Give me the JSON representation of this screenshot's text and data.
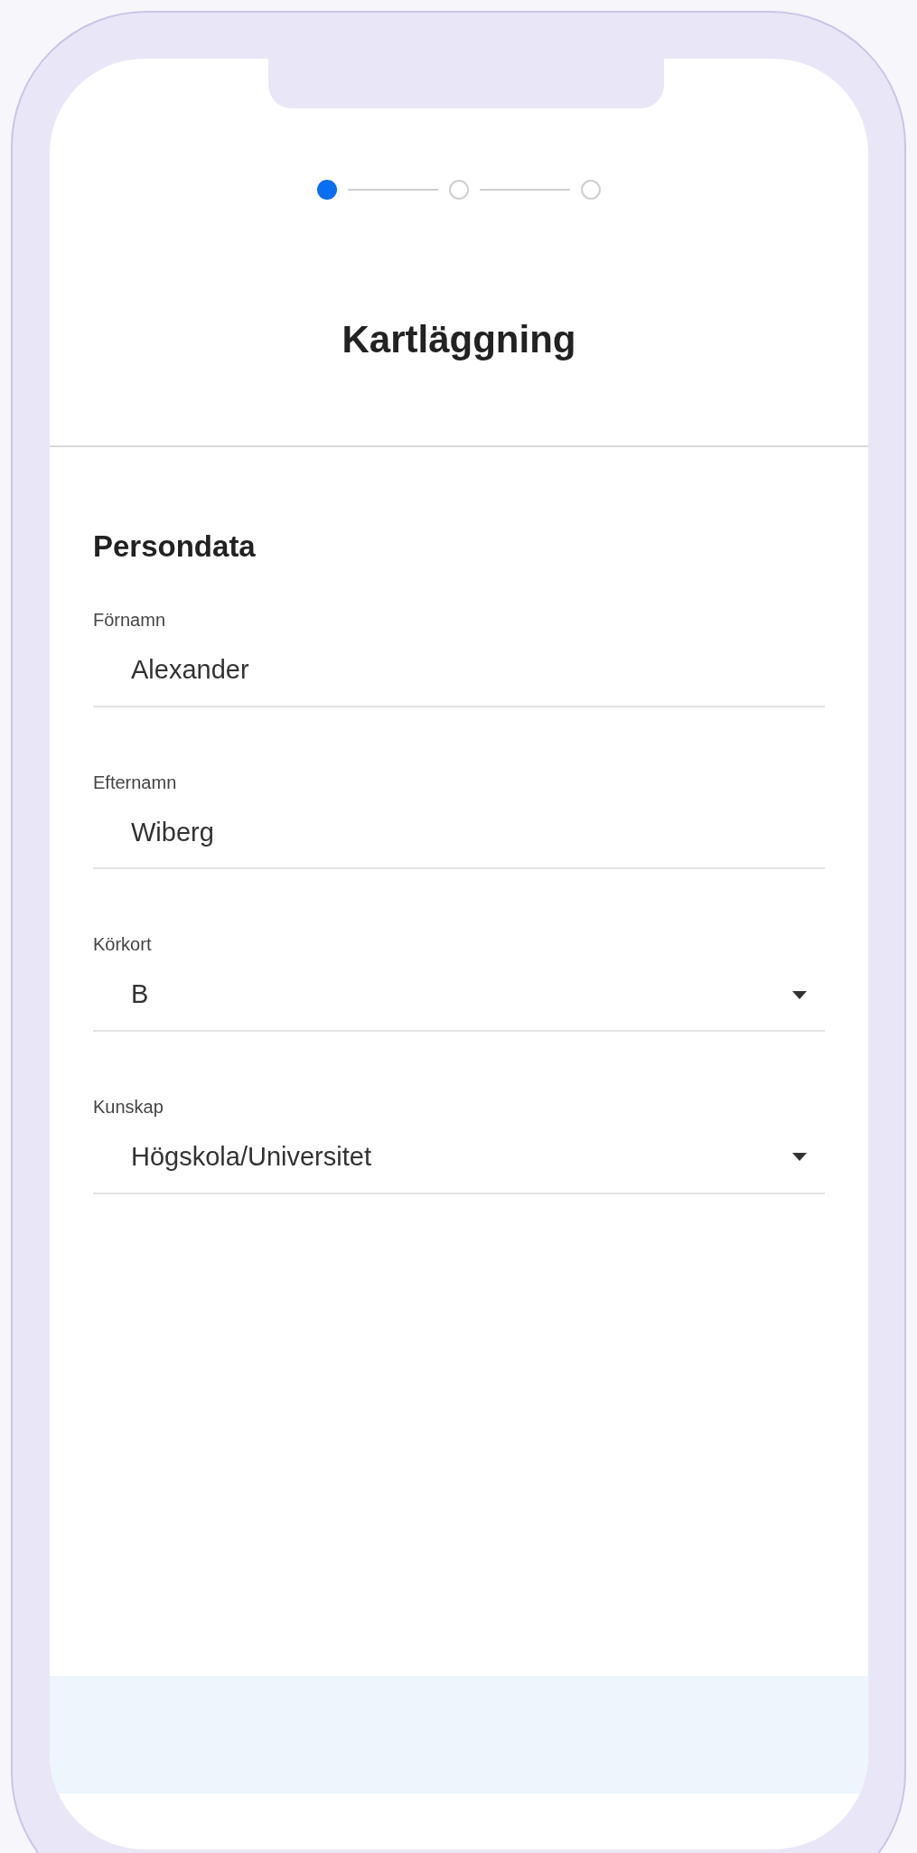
{
  "stepper": [
    {
      "selected": true
    },
    {
      "selected": false
    },
    {
      "selected": false
    }
  ],
  "title": "Kartläggning",
  "section_title": "Persondata",
  "fields": [
    {
      "kind": "text",
      "label": "Förnamn",
      "value": "Alexander"
    },
    {
      "kind": "text",
      "label": "Efternamn",
      "value": "Wiberg"
    },
    {
      "kind": "select",
      "label": "Körkort",
      "value": "B"
    },
    {
      "kind": "select",
      "label": "Kunskap",
      "value": "Högskola/Universitet"
    }
  ]
}
